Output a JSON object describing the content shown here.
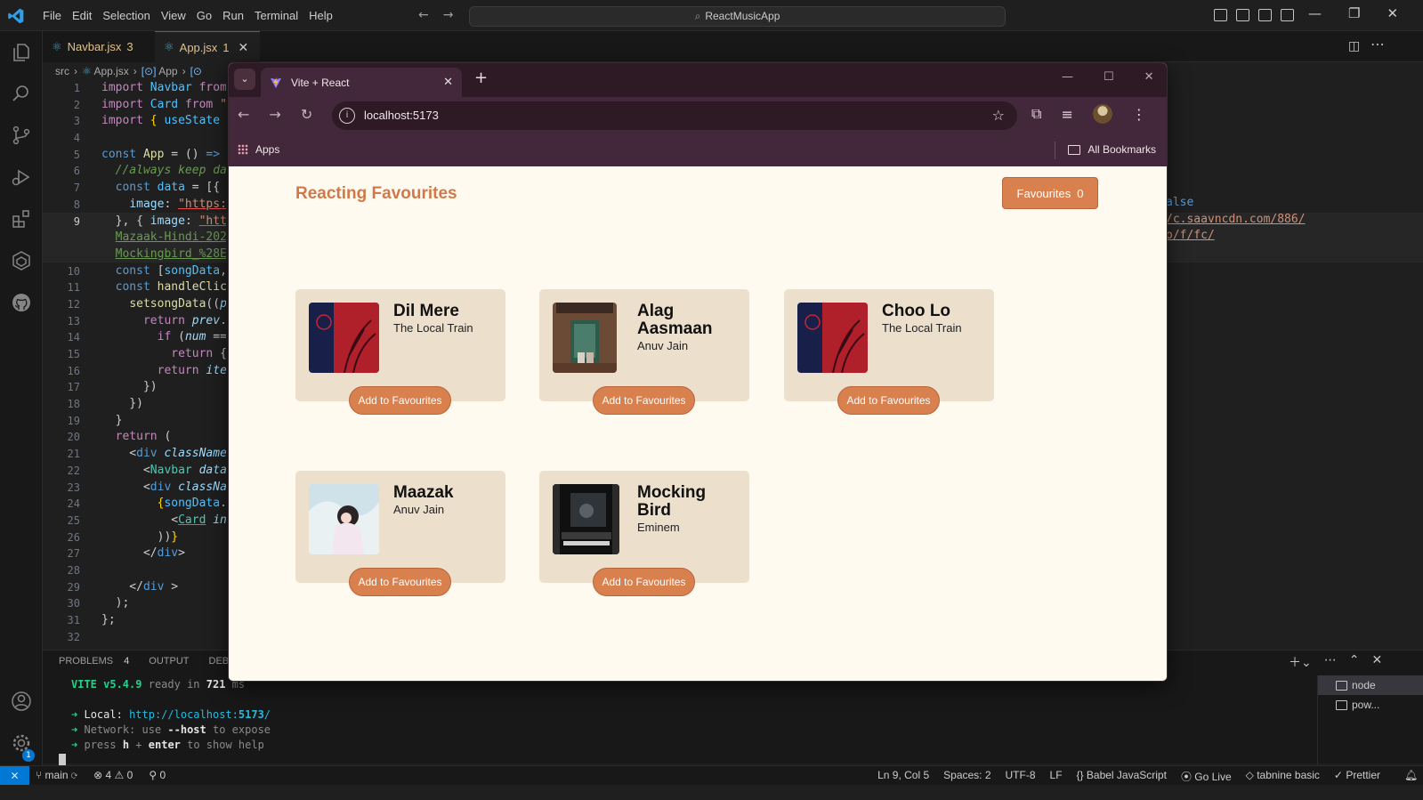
{
  "vscode": {
    "menu": [
      "File",
      "Edit",
      "Selection",
      "View",
      "Go",
      "Run",
      "Terminal",
      "Help"
    ],
    "search": "ReactMusicApp",
    "tabs": [
      {
        "label": "Navbar.jsx",
        "count": "3"
      },
      {
        "label": "App.jsx",
        "count": "1"
      }
    ],
    "breadcrumb": {
      "src": "src",
      "file": "App.jsx",
      "symbol": "App"
    },
    "line_numbers": [
      "1",
      "2",
      "3",
      "4",
      "5",
      "6",
      "7",
      "8",
      "9",
      "",
      "",
      "10",
      "11",
      "12",
      "13",
      "14",
      "15",
      "16",
      "17",
      "18",
      "19",
      "20",
      "21",
      "22",
      "23",
      "24",
      "25",
      "26",
      "27",
      "28",
      "29",
      "30",
      "31",
      "32"
    ],
    "right_code": {
      "line1": "alse",
      "line2": "/c.saavncdn.com/886/",
      "line3": "o/f/fc/"
    },
    "panel": {
      "tabs": [
        "PROBLEMS",
        "OUTPUT",
        "DEBU"
      ],
      "problems_count": "4",
      "terminal": {
        "vite": "VITE v5.4.9",
        "ready": "ready in",
        "ms": "721",
        "ms_unit": "ms",
        "local_label": "Local:",
        "local_url": "http://localhost:",
        "local_port": "5173",
        "network": "Network: use",
        "host": "--host",
        "expose": "to expose",
        "press": "press",
        "h": "h",
        "plus": "+",
        "enter": "enter",
        "help": "to show help"
      },
      "terminals": [
        "node",
        "pow..."
      ]
    },
    "status": {
      "branch": "main",
      "errors": "4",
      "warnings": "0",
      "ports": "0",
      "position": "Ln 9, Col 5",
      "spaces": "Spaces: 2",
      "encoding": "UTF-8",
      "eol": "LF",
      "language": "Babel JavaScript",
      "golive": "Go Live",
      "tabnine": "tabnine basic",
      "prettier": "Prettier"
    },
    "accounts_badge": "1"
  },
  "browser": {
    "tab_title": "Vite + React",
    "url": "localhost:5173",
    "bookmarks": {
      "apps": "Apps",
      "all": "All Bookmarks"
    }
  },
  "app": {
    "brand": "Reacting Favourites",
    "fav_label": "Favourites",
    "fav_count": "0",
    "add_label": "Add to Favourites",
    "songs": [
      {
        "title": "Dil Mere",
        "artist": "The Local Train"
      },
      {
        "title": "Alag Aasmaan",
        "artist": "Anuv Jain"
      },
      {
        "title": "Choo Lo",
        "artist": "The Local Train"
      },
      {
        "title": "Maazak",
        "artist": "Anuv Jain"
      },
      {
        "title": "Mocking Bird",
        "artist": "Eminem"
      }
    ]
  },
  "colors": {
    "accent": "#d8804e",
    "card": "#ecdfcc",
    "page_bg": "#fffaf0",
    "vscode_blue": "#0078d4"
  }
}
